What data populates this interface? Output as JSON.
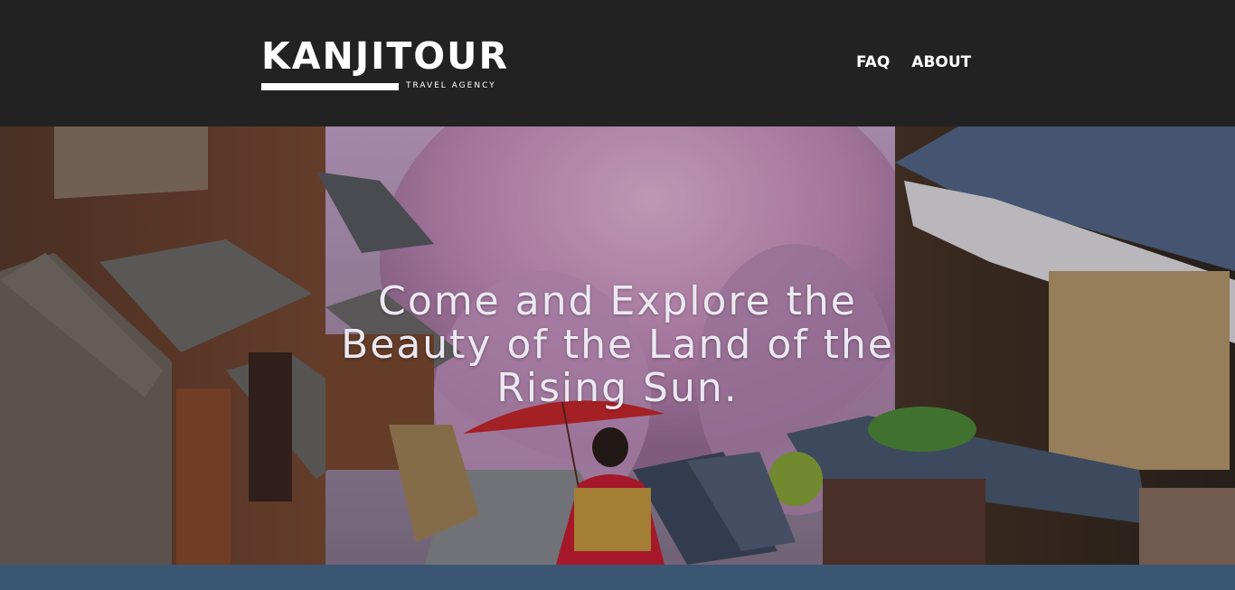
{
  "brand": {
    "name": "KANJITOUR",
    "tagline": "TRAVEL AGENCY"
  },
  "nav": {
    "items": [
      {
        "label": "FAQ"
      },
      {
        "label": "ABOUT"
      }
    ]
  },
  "hero": {
    "title": "Come and Explore the Beauty of the Land of the Rising Sun.",
    "image": "kyoto-street-cherry-blossom-kimono-red-umbrella"
  },
  "colors": {
    "header_bg": "#222222",
    "footer_bar": "#3b5673",
    "hero_text": "#ece8f2"
  }
}
